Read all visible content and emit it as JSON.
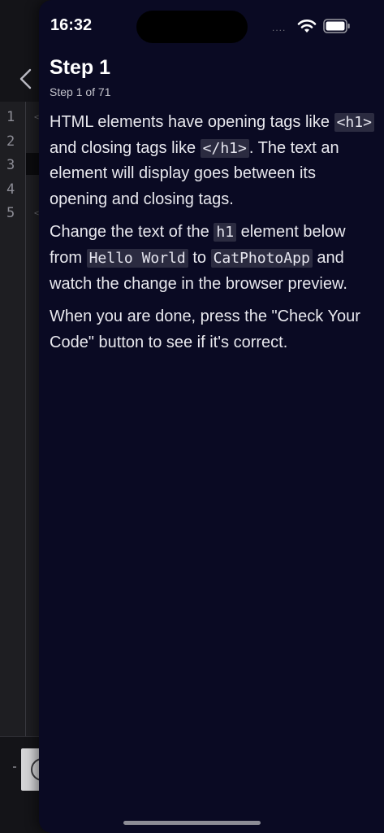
{
  "status_bar": {
    "time": "16:32",
    "signal": "....",
    "wifi_icon": "wifi-icon",
    "battery_icon": "battery-icon"
  },
  "editor": {
    "line_numbers": [
      "1",
      "2",
      "3",
      "4",
      "5"
    ],
    "line_marks": [
      "<",
      "",
      "",
      "",
      "<"
    ]
  },
  "header": {
    "back_icon": "chevron-left-icon",
    "title": "Step 1",
    "subtitle": "Step 1 of 71"
  },
  "instructions": {
    "p1": {
      "t1": "HTML elements have opening tags like ",
      "c1": "<h1>",
      "t2": " and closing tags like ",
      "c2": "</h1>",
      "t3": ". The text an element will display goes between its opening and closing tags."
    },
    "p2": {
      "t1": "Change the text of the ",
      "c1": "h1",
      "t2": " element below from ",
      "c2": "Hello World",
      "t3": " to ",
      "c3": "CatPhotoApp",
      "t4": " and watch the change in the browser preview."
    },
    "p3": {
      "t1": "When you are done, press the \"Check Your Code\" button to see if it's correct."
    }
  },
  "colors": {
    "sheet_background": "#0a0a23",
    "code_background": "#2b2b40",
    "text": "#e8e8ee"
  }
}
